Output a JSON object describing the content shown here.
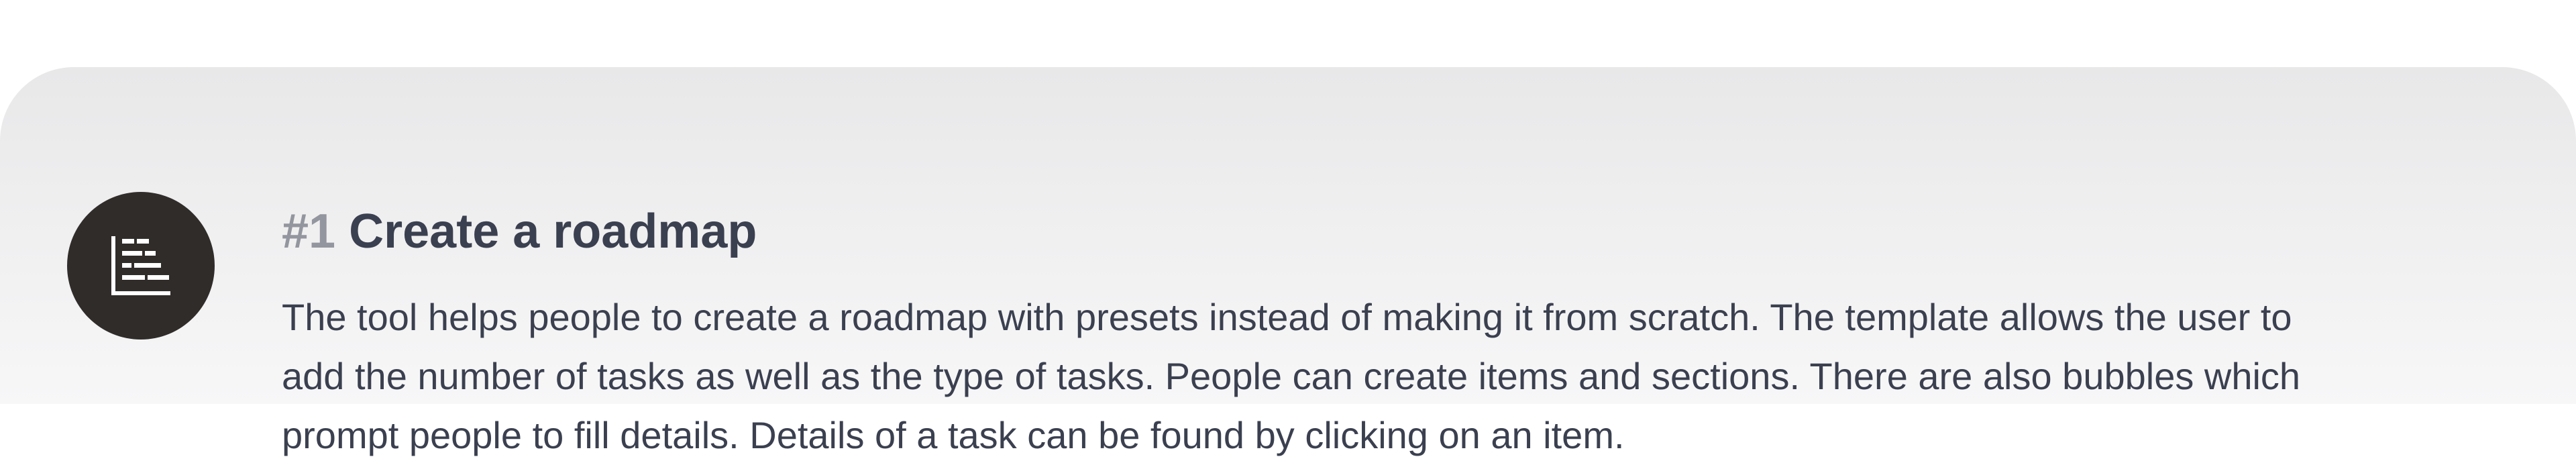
{
  "item": {
    "number": "#1",
    "title": "Create a roadmap",
    "icon": "roadmap-gantt-icon",
    "description_lines": [
      "The tool helps people to create a roadmap with presets instead of making it from scratch. The template allows the user to",
      "add the number of tasks as well as the type of tasks. People can create items and sections. There are also bubbles which",
      "prompt people to fill details. Details of a task can be found by clicking on an item."
    ]
  },
  "colors": {
    "icon_background": "#302c2a",
    "title_text": "#3b4050",
    "number_text": "#93969e",
    "card_background": "#ececed"
  }
}
